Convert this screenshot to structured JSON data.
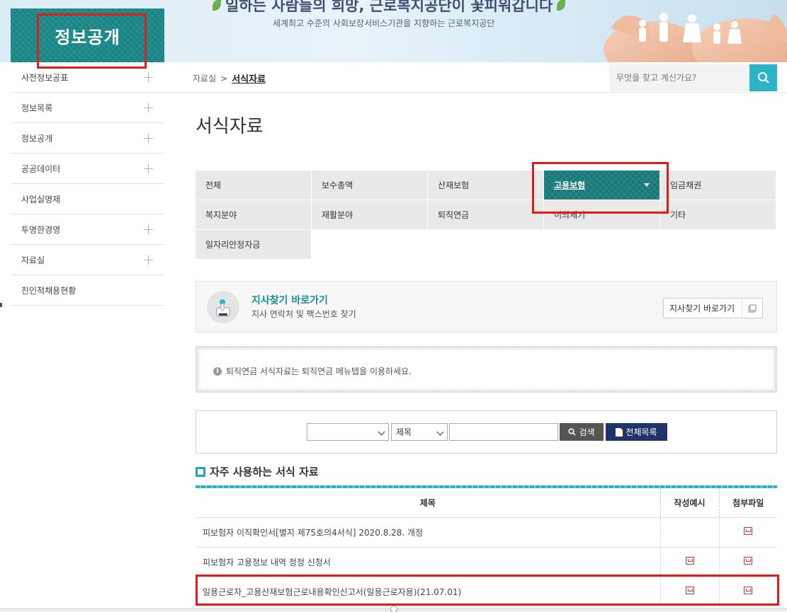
{
  "header": {
    "logo": "정보공개",
    "slogan": "일하는 사람들의 희망, 근로복지공단이 꽃피워갑니다",
    "subslogan": "세계최고 수준의 사회보장서비스기관을 지향하는 근로복지공단"
  },
  "sidebar": {
    "items": [
      {
        "label": "사전정보공표",
        "plus": "+"
      },
      {
        "label": "정보목록",
        "plus": "+"
      },
      {
        "label": "정보공개",
        "plus": "+"
      },
      {
        "label": "공공데이터",
        "plus": "+"
      },
      {
        "label": "사업실명제",
        "plus": ""
      },
      {
        "label": "투명한경영",
        "plus": "+"
      },
      {
        "label": "자료실",
        "plus": "+"
      },
      {
        "label": "친인척채용현황",
        "plus": ""
      }
    ]
  },
  "breadcrumb": {
    "parent": "자료실",
    "separator": ">",
    "current": "서식자료"
  },
  "search": {
    "placeholder": "무엇을 찾고 계신가요?"
  },
  "page": {
    "title": "서식자료"
  },
  "tabs": {
    "row1": [
      "전체",
      "보수총액",
      "산재보험",
      "고용보험",
      "임금채권"
    ],
    "row2": [
      "복지분야",
      "재활분야",
      "퇴직연금",
      "이의제기",
      "기타"
    ],
    "row3": [
      "일자리안정자금"
    ],
    "active": "고용보험"
  },
  "branch": {
    "title": "지사찾기 바로가기",
    "subtitle": "지사 연락처 및 팩스번호 찾기",
    "button": "지사찾기 바로가기"
  },
  "notice": {
    "text": "퇴직연금 서식자료는 퇴직연금 메뉴탭을 이용하세요."
  },
  "filter": {
    "category_value": "",
    "field_value": "제목",
    "keyword_value": "",
    "search_button": "검색",
    "list_button": "전체목록"
  },
  "section": {
    "title": "자주 사용하는 서식 자료"
  },
  "table": {
    "headers": [
      "제목",
      "작성예시",
      "첨부파일"
    ],
    "rows": [
      {
        "title": "피보험자 이직확인서[별지 제75호의4서식] 2020.8.28. 개정",
        "example": false,
        "file": true
      },
      {
        "title": "피보험자 고용정보 내역 정정 신청서",
        "example": true,
        "file": true
      },
      {
        "title": "일용근로자_고용산재보험근로내용확인신고서(일용근로자용)(21.07.01)",
        "example": true,
        "file": true
      }
    ]
  },
  "colors": {
    "teal": "#1b7f7f",
    "accent": "#2bb4c5",
    "navy": "#1f3567",
    "highlight": "#e21b1b"
  }
}
